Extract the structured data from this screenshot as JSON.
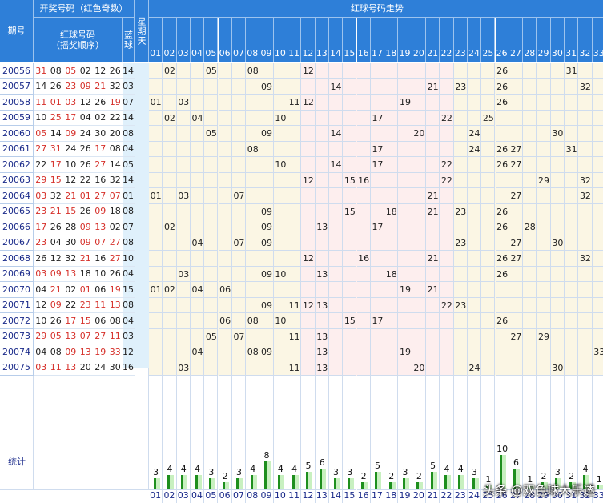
{
  "header": {
    "period": "期号",
    "draw_group": "开奖号码（红色奇数）",
    "red_order_l1": "红球号码",
    "red_order_l2": "（摇奖顺序）",
    "blue": "蓝球",
    "weekday": "星期天",
    "trend": "红球号码走势"
  },
  "columns": [
    "01",
    "02",
    "03",
    "04",
    "05",
    "06",
    "07",
    "08",
    "09",
    "10",
    "11",
    "12",
    "13",
    "14",
    "15",
    "16",
    "17",
    "18",
    "19",
    "20",
    "21",
    "22",
    "23",
    "24",
    "25",
    "26",
    "27",
    "28",
    "29",
    "30",
    "31",
    "32",
    "33"
  ],
  "stats_label": "统计",
  "watermark": "头条 @双色球大乐透",
  "colors": {
    "header": "#2e7fd8",
    "odd": "#d6302a",
    "even": "#222222",
    "bar": "#1e8f1e",
    "zone_a": "#fbf6e4",
    "zone_b": "#fdeeee"
  },
  "chart_data": {
    "type": "table",
    "rows": [
      {
        "period": "20056",
        "red": [
          "31",
          "08",
          "05",
          "02",
          "12",
          "26"
        ],
        "blue": "14"
      },
      {
        "period": "20057",
        "red": [
          "14",
          "26",
          "23",
          "09",
          "21",
          "32"
        ],
        "blue": "03"
      },
      {
        "period": "20058",
        "red": [
          "11",
          "01",
          "03",
          "12",
          "26",
          "19"
        ],
        "blue": "07"
      },
      {
        "period": "20059",
        "red": [
          "10",
          "25",
          "17",
          "04",
          "02",
          "22"
        ],
        "blue": "14"
      },
      {
        "period": "20060",
        "red": [
          "05",
          "14",
          "09",
          "24",
          "30",
          "20"
        ],
        "blue": "08"
      },
      {
        "period": "20061",
        "red": [
          "27",
          "31",
          "24",
          "26",
          "17",
          "08"
        ],
        "blue": "04"
      },
      {
        "period": "20062",
        "red": [
          "22",
          "17",
          "10",
          "26",
          "27",
          "14"
        ],
        "blue": "05"
      },
      {
        "period": "20063",
        "red": [
          "29",
          "15",
          "12",
          "22",
          "16",
          "32"
        ],
        "blue": "14"
      },
      {
        "period": "20064",
        "red": [
          "03",
          "32",
          "21",
          "01",
          "27",
          "07"
        ],
        "blue": "01"
      },
      {
        "period": "20065",
        "red": [
          "23",
          "21",
          "15",
          "26",
          "09",
          "18"
        ],
        "blue": "08"
      },
      {
        "period": "20066",
        "red": [
          "17",
          "26",
          "28",
          "09",
          "13",
          "02"
        ],
        "blue": "07"
      },
      {
        "period": "20067",
        "red": [
          "23",
          "04",
          "30",
          "09",
          "07",
          "27"
        ],
        "blue": "08"
      },
      {
        "period": "20068",
        "red": [
          "26",
          "12",
          "32",
          "21",
          "16",
          "27"
        ],
        "blue": "10"
      },
      {
        "period": "20069",
        "red": [
          "03",
          "09",
          "13",
          "18",
          "10",
          "26"
        ],
        "blue": "04"
      },
      {
        "period": "20070",
        "red": [
          "04",
          "21",
          "02",
          "01",
          "06",
          "19"
        ],
        "blue": "15"
      },
      {
        "period": "20071",
        "red": [
          "12",
          "09",
          "22",
          "23",
          "11",
          "13"
        ],
        "blue": "08"
      },
      {
        "period": "20072",
        "red": [
          "10",
          "26",
          "17",
          "15",
          "06",
          "08"
        ],
        "blue": "04"
      },
      {
        "period": "20073",
        "red": [
          "29",
          "05",
          "13",
          "07",
          "27",
          "11"
        ],
        "blue": "03"
      },
      {
        "period": "20074",
        "red": [
          "04",
          "08",
          "09",
          "13",
          "19",
          "33"
        ],
        "blue": "12"
      },
      {
        "period": "20075",
        "red": [
          "03",
          "11",
          "13",
          "20",
          "24",
          "30"
        ],
        "blue": "16"
      }
    ],
    "stats": [
      3,
      4,
      4,
      4,
      3,
      2,
      3,
      4,
      8,
      4,
      4,
      5,
      6,
      3,
      3,
      2,
      5,
      2,
      3,
      2,
      5,
      4,
      4,
      3,
      1,
      10,
      6,
      1,
      2,
      3,
      2,
      4,
      1
    ]
  }
}
